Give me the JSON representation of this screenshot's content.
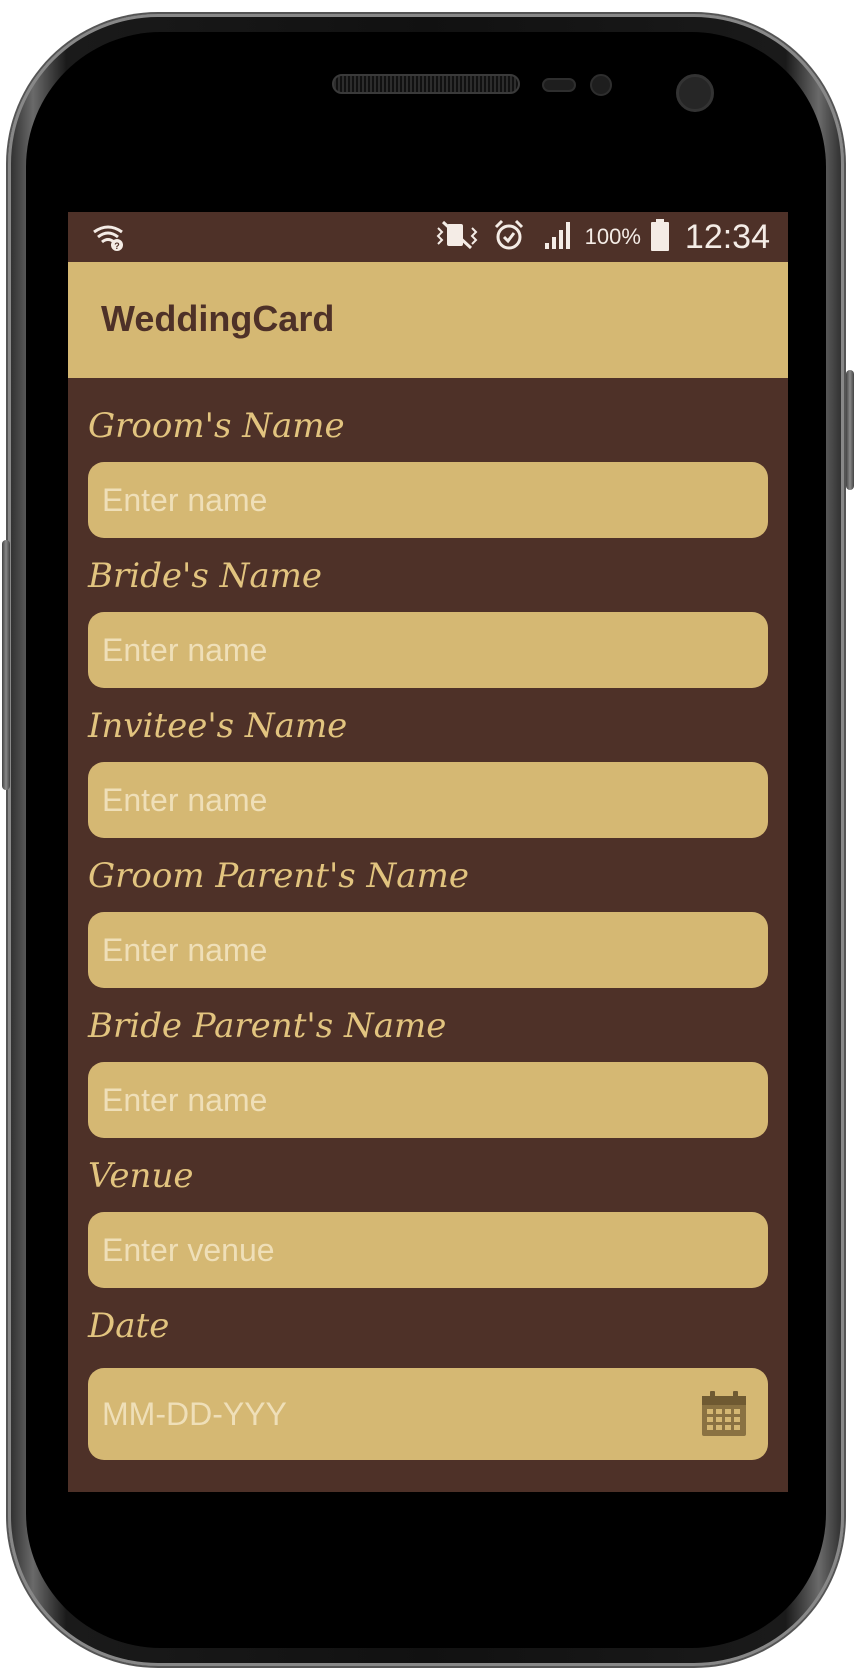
{
  "status_bar": {
    "battery_percent": "100%",
    "time": "12:34",
    "icons": [
      "wifi-question-icon",
      "vibrate-mute-icon",
      "alarm-icon",
      "signal-icon",
      "battery-icon"
    ]
  },
  "app_bar": {
    "title": "WeddingCard"
  },
  "form": {
    "fields": [
      {
        "label": "Groom's Name",
        "placeholder": "Enter name"
      },
      {
        "label": "Bride's Name",
        "placeholder": "Enter name"
      },
      {
        "label": "Invitee's Name",
        "placeholder": "Enter name"
      },
      {
        "label": "Groom Parent's Name",
        "placeholder": "Enter name"
      },
      {
        "label": "Bride Parent's Name",
        "placeholder": "Enter name"
      },
      {
        "label": "Venue",
        "placeholder": "Enter venue"
      },
      {
        "label": "Date",
        "placeholder": "MM-DD-YYY",
        "icon": "calendar-icon"
      }
    ]
  },
  "colors": {
    "background": "#4e3128",
    "accent": "#d5b873",
    "label": "#e2c47f",
    "placeholder": "#efdfb8"
  }
}
